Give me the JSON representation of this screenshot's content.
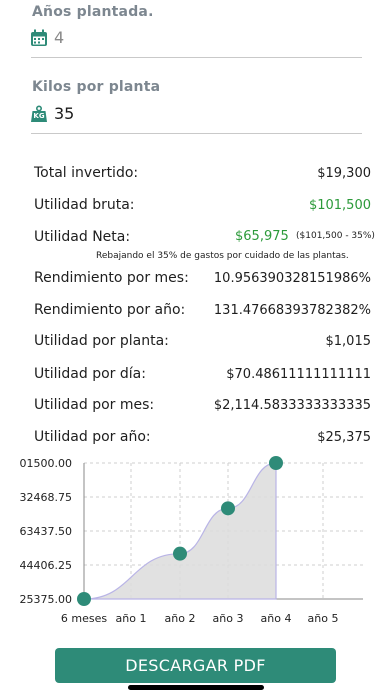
{
  "form": {
    "anos": {
      "label": "Años plantada.",
      "value": "4",
      "icon": "calendar-icon"
    },
    "kilos": {
      "label": "Kilos por planta",
      "value": "35",
      "icon": "kg-weight-icon",
      "icon_text": "KG"
    }
  },
  "results": {
    "total_invertido": {
      "label": "Total invertido:",
      "value": "$19,300"
    },
    "utilidad_bruta": {
      "label": "Utilidad bruta:",
      "value": "$101,500"
    },
    "utilidad_neta": {
      "label": "Utilidad Neta:",
      "value": "$65,975",
      "detail": "($101,500 - 35%)"
    },
    "note": "Rebajando el 35% de gastos por cuidado de las plantas.",
    "rend_mes": {
      "label": "Rendimiento por mes:",
      "value": "10.956390328151986%"
    },
    "rend_ano": {
      "label": "Rendimiento por año:",
      "value": "131.47668393782382%"
    },
    "util_planta": {
      "label": "Utilidad por planta:",
      "value": "$1,015"
    },
    "util_dia": {
      "label": "Utilidad por día:",
      "value": "$70.48611111111111"
    },
    "util_mes": {
      "label": "Utilidad por mes:",
      "value": "$2,114.5833333333335"
    },
    "util_ano": {
      "label": "Utilidad por año:",
      "value": "$25,375"
    }
  },
  "colors": {
    "green": "#2c9a3a",
    "accent": "#2e8b78",
    "point": "#2e8b78"
  },
  "chart_data": {
    "type": "area",
    "categories": [
      "6 meses",
      "año 1",
      "año 2",
      "año 3",
      "año 4",
      "año 5"
    ],
    "values": [
      25375,
      50750,
      76125,
      101500
    ],
    "value_categories": [
      "6 meses",
      "año 2",
      "año 3",
      "año 4"
    ],
    "y_tick_labels": [
      "01500.00",
      "32468.75",
      "63437.50",
      "44406.25",
      "25375.00"
    ],
    "ylim": [
      25375,
      101500
    ],
    "grid": true,
    "title": "",
    "xlabel": "",
    "ylabel": ""
  },
  "download_button": {
    "label": "DESCARGAR PDF"
  }
}
